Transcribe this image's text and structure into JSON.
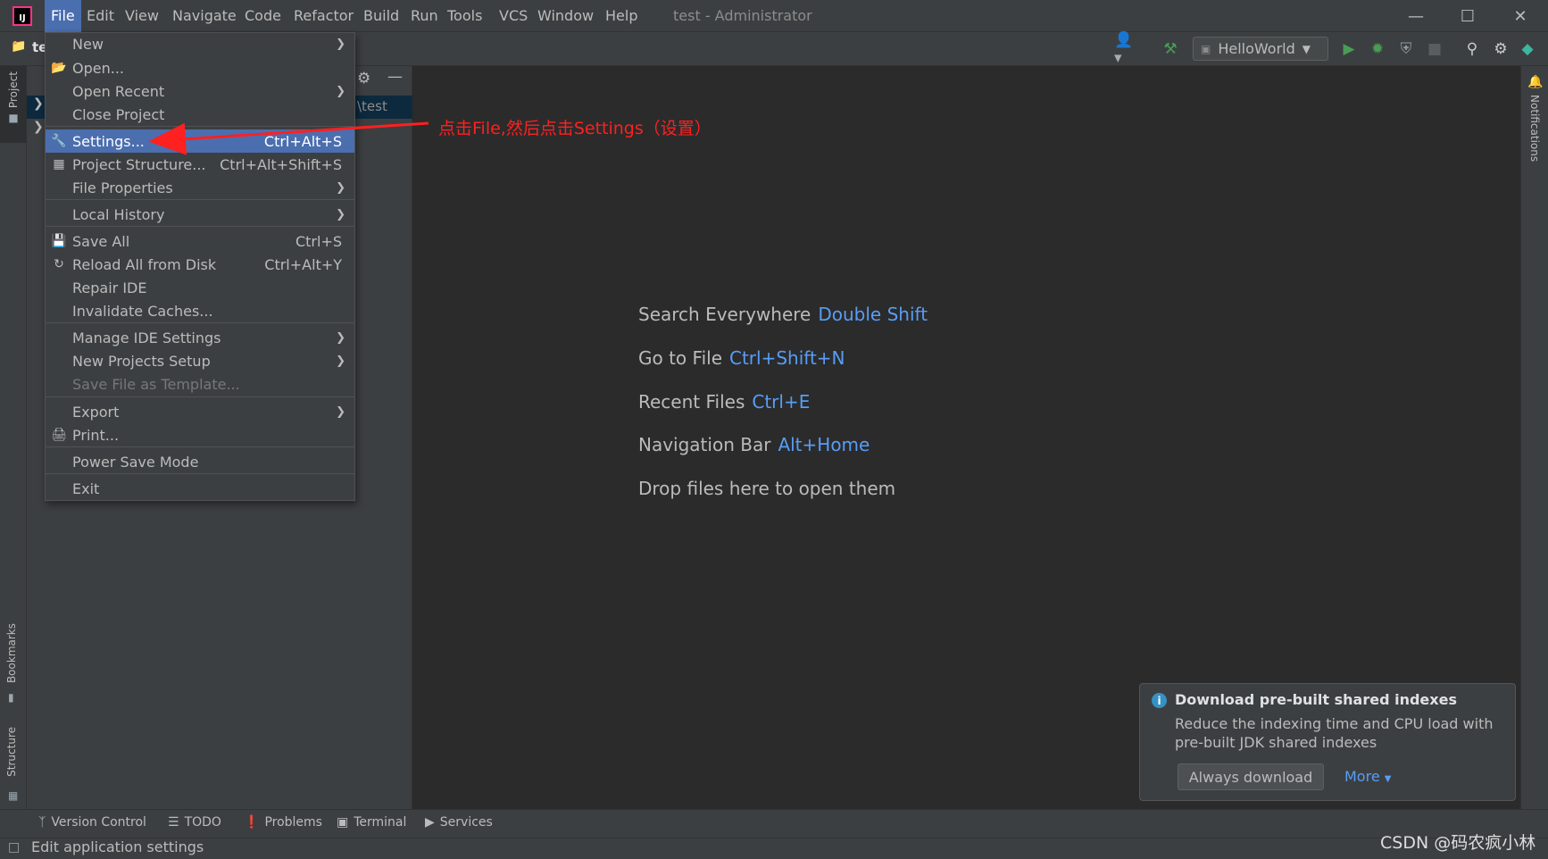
{
  "title_bar": {
    "menus": [
      "File",
      "Edit",
      "View",
      "Navigate",
      "Code",
      "Refactor",
      "Build",
      "Run",
      "Tools",
      "VCS",
      "Window",
      "Help"
    ],
    "window_title": "test - Administrator"
  },
  "toolbar": {
    "project_name": "te",
    "run_config": "HelloWorld"
  },
  "project_panel": {
    "path_fragment": "\\test"
  },
  "left_stripe": {
    "project": "Project",
    "bookmarks": "Bookmarks",
    "structure": "Structure"
  },
  "right_stripe": {
    "notifications": "Notifications"
  },
  "file_menu": {
    "items": [
      {
        "label": "New",
        "shortcut": "",
        "submenu": true,
        "icon": ""
      },
      {
        "label": "Open...",
        "shortcut": "",
        "submenu": false,
        "icon": "folder-icon"
      },
      {
        "label": "Open Recent",
        "shortcut": "",
        "submenu": true,
        "icon": ""
      },
      {
        "label": "Close Project",
        "shortcut": "",
        "submenu": false,
        "icon": ""
      },
      {
        "label": "Settings...",
        "shortcut": "Ctrl+Alt+S",
        "submenu": false,
        "icon": "wrench-icon"
      },
      {
        "label": "Project Structure...",
        "shortcut": "Ctrl+Alt+Shift+S",
        "submenu": false,
        "icon": "project-structure-icon"
      },
      {
        "label": "File Properties",
        "shortcut": "",
        "submenu": true,
        "icon": ""
      },
      {
        "label": "Local History",
        "shortcut": "",
        "submenu": true,
        "icon": ""
      },
      {
        "label": "Save All",
        "shortcut": "Ctrl+S",
        "submenu": false,
        "icon": "save-icon"
      },
      {
        "label": "Reload All from Disk",
        "shortcut": "Ctrl+Alt+Y",
        "submenu": false,
        "icon": "reload-icon"
      },
      {
        "label": "Repair IDE",
        "shortcut": "",
        "submenu": false,
        "icon": ""
      },
      {
        "label": "Invalidate Caches...",
        "shortcut": "",
        "submenu": false,
        "icon": ""
      },
      {
        "label": "Manage IDE Settings",
        "shortcut": "",
        "submenu": true,
        "icon": ""
      },
      {
        "label": "New Projects Setup",
        "shortcut": "",
        "submenu": true,
        "icon": ""
      },
      {
        "label": "Save File as Template...",
        "shortcut": "",
        "submenu": false,
        "icon": "",
        "disabled": true
      },
      {
        "label": "Export",
        "shortcut": "",
        "submenu": true,
        "icon": ""
      },
      {
        "label": "Print...",
        "shortcut": "",
        "submenu": false,
        "icon": "print-icon"
      },
      {
        "label": "Power Save Mode",
        "shortcut": "",
        "submenu": false,
        "icon": ""
      },
      {
        "label": "Exit",
        "shortcut": "",
        "submenu": false,
        "icon": ""
      }
    ],
    "selected": "Settings..."
  },
  "annotation": {
    "text": "点击File,然后点击Settings（设置）",
    "color": "#ff2020"
  },
  "editor_hints": [
    {
      "label": "Search Everywhere",
      "key": "Double Shift"
    },
    {
      "label": "Go to File",
      "key": "Ctrl+Shift+N"
    },
    {
      "label": "Recent Files",
      "key": "Ctrl+E"
    },
    {
      "label": "Navigation Bar",
      "key": "Alt+Home"
    },
    {
      "label": "Drop files here to open them",
      "key": ""
    }
  ],
  "notification": {
    "title": "Download pre-built shared indexes",
    "text": "Reduce the indexing time and CPU load with pre-built JDK shared indexes",
    "primary_button": "Always download",
    "more_link": "More"
  },
  "bottom_tools": [
    "Version Control",
    "TODO",
    "Problems",
    "Terminal",
    "Services"
  ],
  "status_bar": {
    "text": "Edit application settings"
  },
  "watermark": "CSDN @码农疯小林",
  "colors": {
    "accent": "#4b6eaf",
    "link": "#589df6",
    "background": "#2b2b2b",
    "panel": "#3c3f41",
    "annotation": "#ff2020"
  }
}
